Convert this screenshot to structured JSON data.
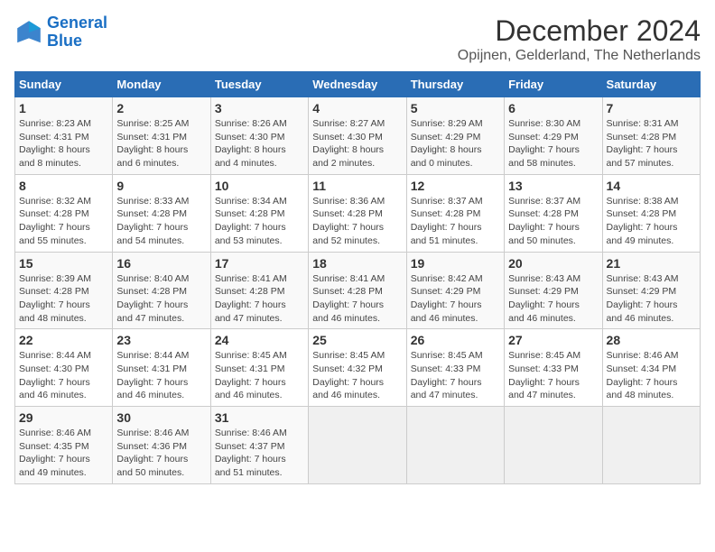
{
  "logo": {
    "line1": "General",
    "line2": "Blue"
  },
  "title": "December 2024",
  "subtitle": "Opijnen, Gelderland, The Netherlands",
  "days_of_week": [
    "Sunday",
    "Monday",
    "Tuesday",
    "Wednesday",
    "Thursday",
    "Friday",
    "Saturday"
  ],
  "weeks": [
    [
      {
        "day": "1",
        "info": "Sunrise: 8:23 AM\nSunset: 4:31 PM\nDaylight: 8 hours\nand 8 minutes."
      },
      {
        "day": "2",
        "info": "Sunrise: 8:25 AM\nSunset: 4:31 PM\nDaylight: 8 hours\nand 6 minutes."
      },
      {
        "day": "3",
        "info": "Sunrise: 8:26 AM\nSunset: 4:30 PM\nDaylight: 8 hours\nand 4 minutes."
      },
      {
        "day": "4",
        "info": "Sunrise: 8:27 AM\nSunset: 4:30 PM\nDaylight: 8 hours\nand 2 minutes."
      },
      {
        "day": "5",
        "info": "Sunrise: 8:29 AM\nSunset: 4:29 PM\nDaylight: 8 hours\nand 0 minutes."
      },
      {
        "day": "6",
        "info": "Sunrise: 8:30 AM\nSunset: 4:29 PM\nDaylight: 7 hours\nand 58 minutes."
      },
      {
        "day": "7",
        "info": "Sunrise: 8:31 AM\nSunset: 4:28 PM\nDaylight: 7 hours\nand 57 minutes."
      }
    ],
    [
      {
        "day": "8",
        "info": "Sunrise: 8:32 AM\nSunset: 4:28 PM\nDaylight: 7 hours\nand 55 minutes."
      },
      {
        "day": "9",
        "info": "Sunrise: 8:33 AM\nSunset: 4:28 PM\nDaylight: 7 hours\nand 54 minutes."
      },
      {
        "day": "10",
        "info": "Sunrise: 8:34 AM\nSunset: 4:28 PM\nDaylight: 7 hours\nand 53 minutes."
      },
      {
        "day": "11",
        "info": "Sunrise: 8:36 AM\nSunset: 4:28 PM\nDaylight: 7 hours\nand 52 minutes."
      },
      {
        "day": "12",
        "info": "Sunrise: 8:37 AM\nSunset: 4:28 PM\nDaylight: 7 hours\nand 51 minutes."
      },
      {
        "day": "13",
        "info": "Sunrise: 8:37 AM\nSunset: 4:28 PM\nDaylight: 7 hours\nand 50 minutes."
      },
      {
        "day": "14",
        "info": "Sunrise: 8:38 AM\nSunset: 4:28 PM\nDaylight: 7 hours\nand 49 minutes."
      }
    ],
    [
      {
        "day": "15",
        "info": "Sunrise: 8:39 AM\nSunset: 4:28 PM\nDaylight: 7 hours\nand 48 minutes."
      },
      {
        "day": "16",
        "info": "Sunrise: 8:40 AM\nSunset: 4:28 PM\nDaylight: 7 hours\nand 47 minutes."
      },
      {
        "day": "17",
        "info": "Sunrise: 8:41 AM\nSunset: 4:28 PM\nDaylight: 7 hours\nand 47 minutes."
      },
      {
        "day": "18",
        "info": "Sunrise: 8:41 AM\nSunset: 4:28 PM\nDaylight: 7 hours\nand 46 minutes."
      },
      {
        "day": "19",
        "info": "Sunrise: 8:42 AM\nSunset: 4:29 PM\nDaylight: 7 hours\nand 46 minutes."
      },
      {
        "day": "20",
        "info": "Sunrise: 8:43 AM\nSunset: 4:29 PM\nDaylight: 7 hours\nand 46 minutes."
      },
      {
        "day": "21",
        "info": "Sunrise: 8:43 AM\nSunset: 4:29 PM\nDaylight: 7 hours\nand 46 minutes."
      }
    ],
    [
      {
        "day": "22",
        "info": "Sunrise: 8:44 AM\nSunset: 4:30 PM\nDaylight: 7 hours\nand 46 minutes."
      },
      {
        "day": "23",
        "info": "Sunrise: 8:44 AM\nSunset: 4:31 PM\nDaylight: 7 hours\nand 46 minutes."
      },
      {
        "day": "24",
        "info": "Sunrise: 8:45 AM\nSunset: 4:31 PM\nDaylight: 7 hours\nand 46 minutes."
      },
      {
        "day": "25",
        "info": "Sunrise: 8:45 AM\nSunset: 4:32 PM\nDaylight: 7 hours\nand 46 minutes."
      },
      {
        "day": "26",
        "info": "Sunrise: 8:45 AM\nSunset: 4:33 PM\nDaylight: 7 hours\nand 47 minutes."
      },
      {
        "day": "27",
        "info": "Sunrise: 8:45 AM\nSunset: 4:33 PM\nDaylight: 7 hours\nand 47 minutes."
      },
      {
        "day": "28",
        "info": "Sunrise: 8:46 AM\nSunset: 4:34 PM\nDaylight: 7 hours\nand 48 minutes."
      }
    ],
    [
      {
        "day": "29",
        "info": "Sunrise: 8:46 AM\nSunset: 4:35 PM\nDaylight: 7 hours\nand 49 minutes."
      },
      {
        "day": "30",
        "info": "Sunrise: 8:46 AM\nSunset: 4:36 PM\nDaylight: 7 hours\nand 50 minutes."
      },
      {
        "day": "31",
        "info": "Sunrise: 8:46 AM\nSunset: 4:37 PM\nDaylight: 7 hours\nand 51 minutes."
      },
      {
        "day": "",
        "info": ""
      },
      {
        "day": "",
        "info": ""
      },
      {
        "day": "",
        "info": ""
      },
      {
        "day": "",
        "info": ""
      }
    ]
  ]
}
